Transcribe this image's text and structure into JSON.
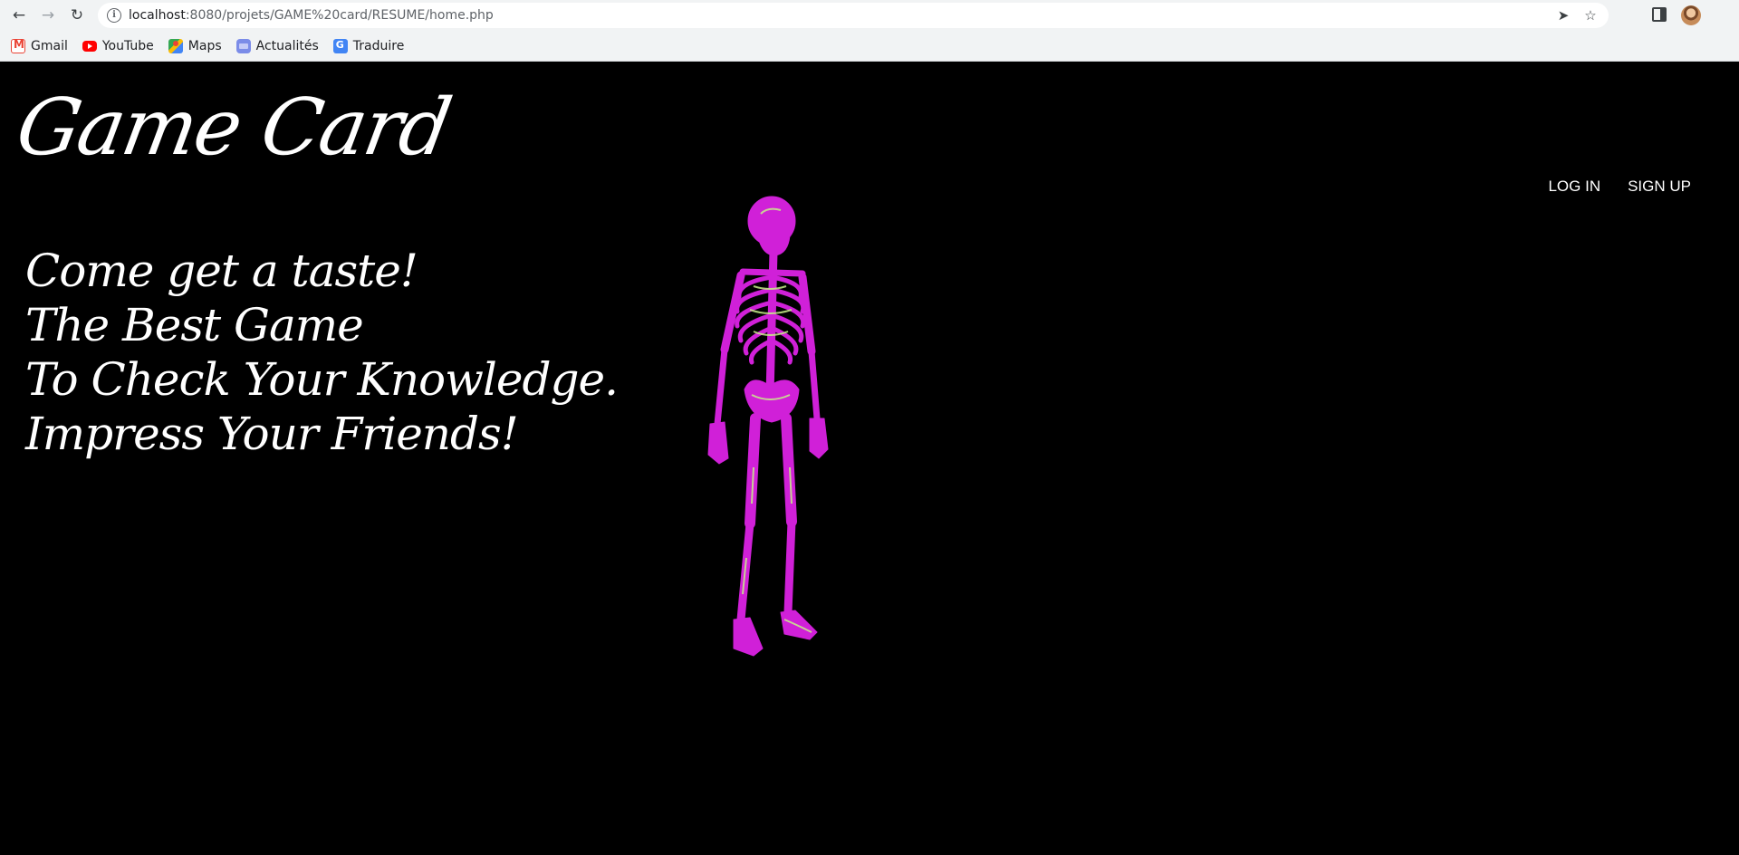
{
  "browser": {
    "url_host": "localhost",
    "url_path": ":8080/projets/GAME%20card/RESUME/home.php",
    "bookmarks": [
      {
        "label": "Gmail",
        "icon": "gmail-icon"
      },
      {
        "label": "YouTube",
        "icon": "youtube-icon"
      },
      {
        "label": "Maps",
        "icon": "maps-icon"
      },
      {
        "label": "Actualités",
        "icon": "news-icon"
      },
      {
        "label": "Traduire",
        "icon": "translate-icon"
      }
    ]
  },
  "page": {
    "logo": "Game Card",
    "nav": {
      "login": "LOG IN",
      "signup": "SIGN UP"
    },
    "hero": [
      "Come get a taste!",
      "The Best Game",
      "To Check Your Knowledge.",
      "Impress Your Friends!"
    ],
    "colors": {
      "background": "#000000",
      "text": "#ffffff",
      "skeleton": "#d020d8",
      "skeleton_highlight": "#c8f08a"
    }
  }
}
